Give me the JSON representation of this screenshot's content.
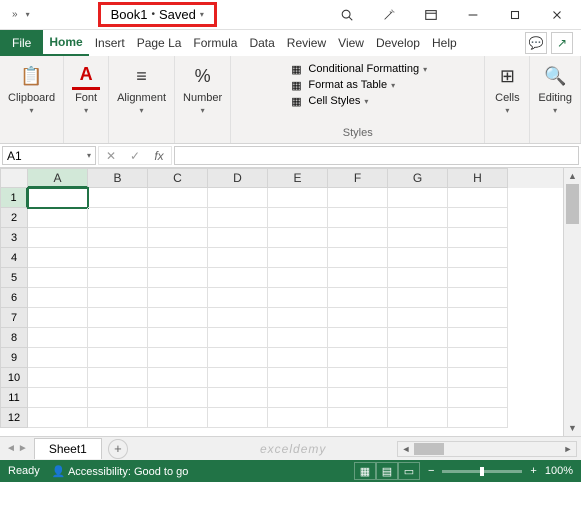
{
  "title": {
    "book": "Book1",
    "status": "Saved"
  },
  "tabs": {
    "file": "File",
    "home": "Home",
    "insert": "Insert",
    "pagela": "Page La",
    "formula": "Formula",
    "data": "Data",
    "review": "Review",
    "view": "View",
    "develop": "Develop",
    "help": "Help"
  },
  "ribbon": {
    "clipboard": {
      "label": "Clipboard"
    },
    "font": {
      "label": "Font"
    },
    "alignment": {
      "label": "Alignment"
    },
    "number": {
      "label": "Number"
    },
    "styles": {
      "label": "Styles",
      "cond": "Conditional Formatting",
      "table": "Format as Table",
      "cells_s": "Cell Styles"
    },
    "cells": {
      "label": "Cells"
    },
    "editing": {
      "label": "Editing"
    }
  },
  "namebox": "A1",
  "columns": [
    "A",
    "B",
    "C",
    "D",
    "E",
    "F",
    "G",
    "H"
  ],
  "rows": [
    "1",
    "2",
    "3",
    "4",
    "5",
    "6",
    "7",
    "8",
    "9",
    "10",
    "11",
    "12"
  ],
  "sheet": {
    "name": "Sheet1"
  },
  "watermark": "exceldemy",
  "status": {
    "ready": "Ready",
    "access": "Accessibility: Good to go",
    "zoom": "100%"
  }
}
